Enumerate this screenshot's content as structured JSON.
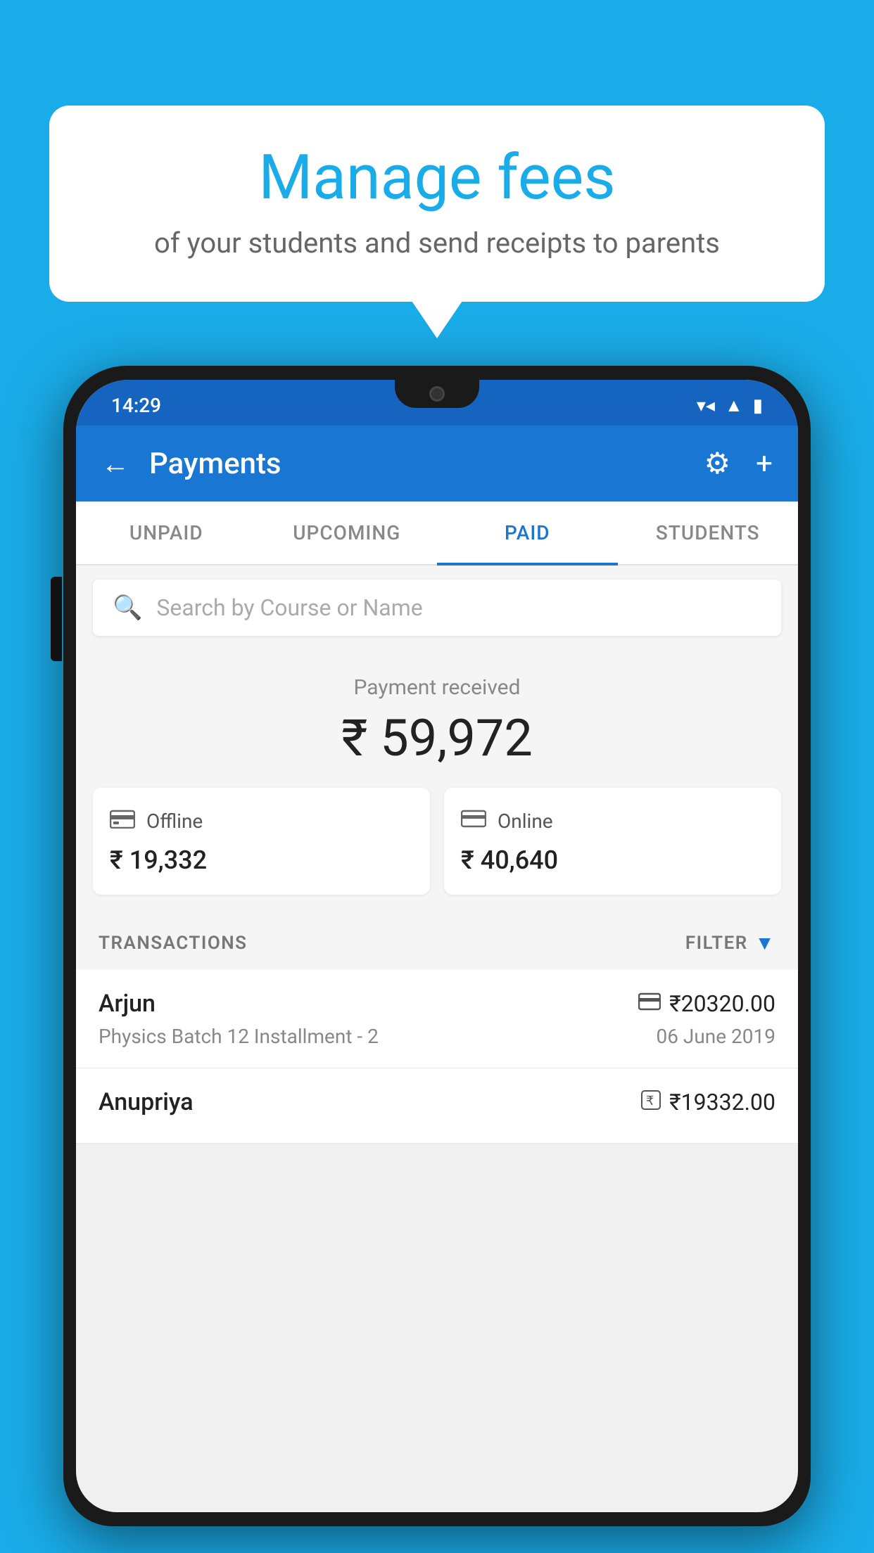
{
  "bubble": {
    "title": "Manage fees",
    "subtitle": "of your students and send receipts to parents"
  },
  "status_bar": {
    "time": "14:29"
  },
  "app_bar": {
    "title": "Payments",
    "back_label": "←",
    "gear_label": "⚙",
    "plus_label": "+"
  },
  "tabs": [
    {
      "label": "UNPAID",
      "active": false
    },
    {
      "label": "UPCOMING",
      "active": false
    },
    {
      "label": "PAID",
      "active": true
    },
    {
      "label": "STUDENTS",
      "active": false
    }
  ],
  "search": {
    "placeholder": "Search by Course or Name"
  },
  "payment_summary": {
    "label": "Payment received",
    "total": "₹ 59,972",
    "offline_label": "Offline",
    "offline_amount": "₹ 19,332",
    "online_label": "Online",
    "online_amount": "₹ 40,640"
  },
  "transactions": {
    "header_label": "TRANSACTIONS",
    "filter_label": "FILTER",
    "rows": [
      {
        "name": "Arjun",
        "course": "Physics Batch 12 Installment - 2",
        "amount": "₹20320.00",
        "date": "06 June 2019",
        "payment_type": "card"
      },
      {
        "name": "Anupriya",
        "course": "",
        "amount": "₹19332.00",
        "date": "",
        "payment_type": "rupee"
      }
    ]
  },
  "icons": {
    "search": "🔍",
    "back": "←",
    "gear": "⚙",
    "plus": "+",
    "filter_triangle": "▼",
    "offline": "₹",
    "online": "💳",
    "card_payment": "💳",
    "rupee_payment": "₹",
    "wifi": "▾",
    "signal": "▲",
    "battery": "▮"
  }
}
